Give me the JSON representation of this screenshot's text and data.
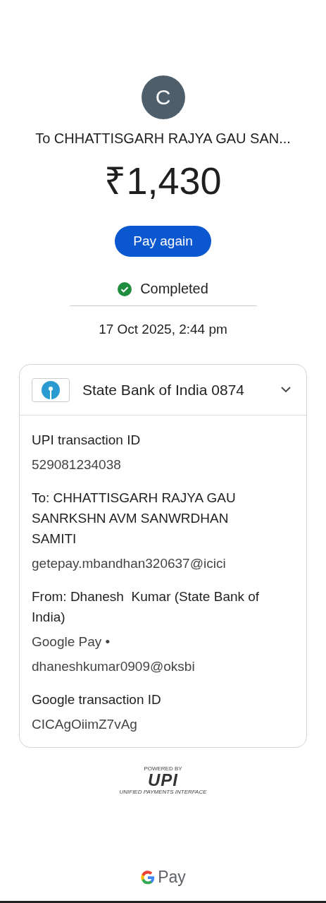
{
  "payee": {
    "initial": "C",
    "title": "To CHHATTISGARH RAJYA GAU SAN..."
  },
  "amount": "₹1,430",
  "pay_again": "Pay again",
  "status": {
    "label": "Completed",
    "kind": "success"
  },
  "date": "17 Oct 2025, 2:44 pm",
  "account": {
    "name": "State Bank of India 0874",
    "expanded": true
  },
  "details": [
    {
      "label": "UPI transaction ID",
      "values": [
        "529081234038"
      ]
    },
    {
      "label": "To: CHHATTISGARH RAJYA GAU SANRKSHN AVM SANWRDHAN SAMITI",
      "values": [
        "getepay.mbandhan320637@icici"
      ]
    },
    {
      "label": "From: Dhanesh  Kumar (State Bank of India)",
      "values": [
        "Google Pay •",
        "dhaneshkumar0909@oksbi"
      ]
    },
    {
      "label": "Google transaction ID",
      "values": [
        "CICAgOiimZ7vAg"
      ]
    }
  ],
  "upi_logo": {
    "top": "POWERED BY",
    "mark": "UPI",
    "bottom": "UNIFIED PAYMENTS INTERFACE"
  },
  "footer": {
    "brand": "Pay"
  }
}
